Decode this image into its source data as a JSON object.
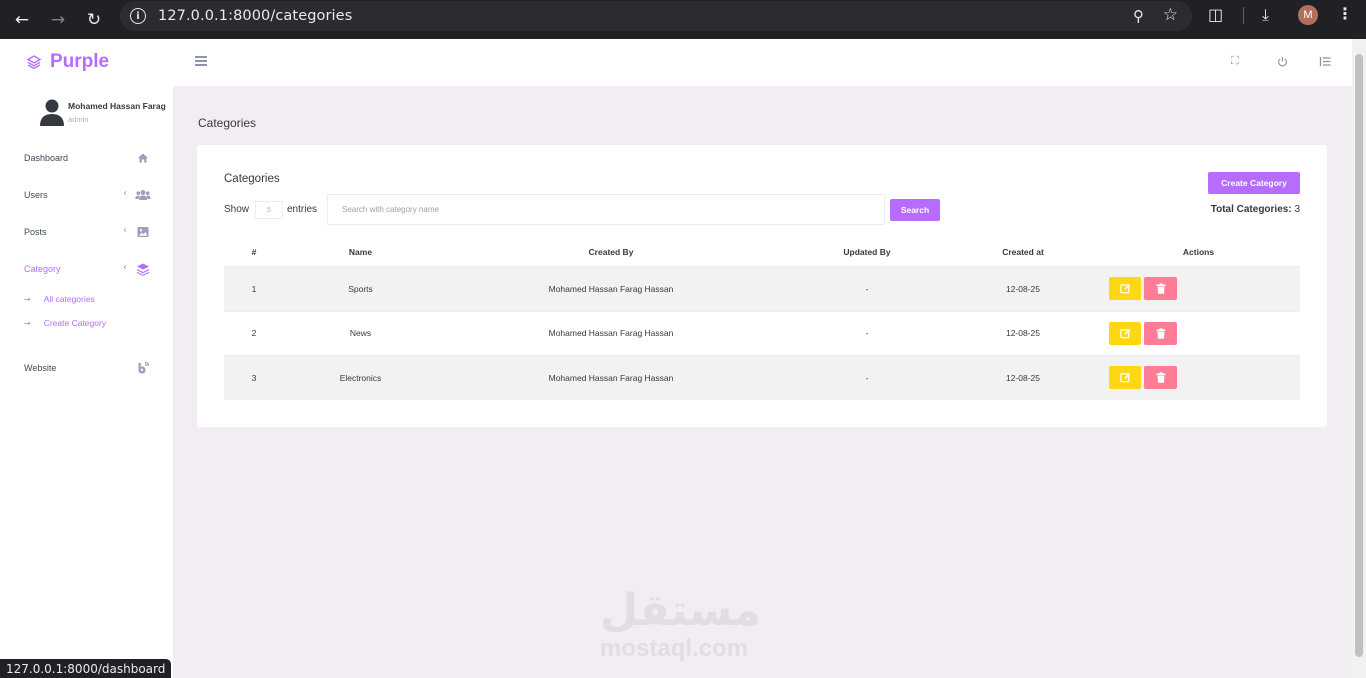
{
  "browser": {
    "url": "127.0.0.1:8000/categories",
    "profile_initial": "M",
    "status_url": "127.0.0.1:8000/dashboard"
  },
  "brand": {
    "name": "Purple",
    "color": "#b66dff"
  },
  "profile": {
    "name": "Mohamed Hassan Farag",
    "role": "admin"
  },
  "sidebar": {
    "items": [
      {
        "label": "Dashboard",
        "icon": "home-icon"
      },
      {
        "label": "Users",
        "icon": "users-icon"
      },
      {
        "label": "Posts",
        "icon": "image-icon"
      },
      {
        "label": "Category",
        "icon": "layers-icon"
      },
      {
        "label": "Website",
        "icon": "blog-icon"
      }
    ],
    "sub_items": [
      "All categories",
      "Create Category"
    ]
  },
  "page": {
    "title": "Categories"
  },
  "card": {
    "title": "Categories",
    "create_label": "Create Category",
    "show_label": "Show",
    "entries_value": "5",
    "entries_label": "entries",
    "search_placeholder": "Search with category name",
    "search_label": "Search",
    "total_label": "Total Categories:",
    "total_value": "3"
  },
  "table": {
    "headers": [
      "#",
      "Name",
      "Created By",
      "Updated By",
      "Created at",
      "Actions"
    ],
    "rows": [
      [
        "1",
        "Sports",
        "Mohamed Hassan Farag Hassan",
        "-",
        "12-08-25"
      ],
      [
        "2",
        "News",
        "Mohamed Hassan Farag Hassan",
        "-",
        "12-08-25"
      ],
      [
        "3",
        "Electronics",
        "Mohamed Hassan Farag Hassan",
        "-",
        "12-08-25"
      ]
    ]
  },
  "watermark": {
    "arabic": "مستقل",
    "latin": "mostaql.com"
  },
  "colors": {
    "primary": "#b66dff",
    "edit": "#fed713",
    "delete": "#fe7c96",
    "background": "#f2edf3"
  }
}
